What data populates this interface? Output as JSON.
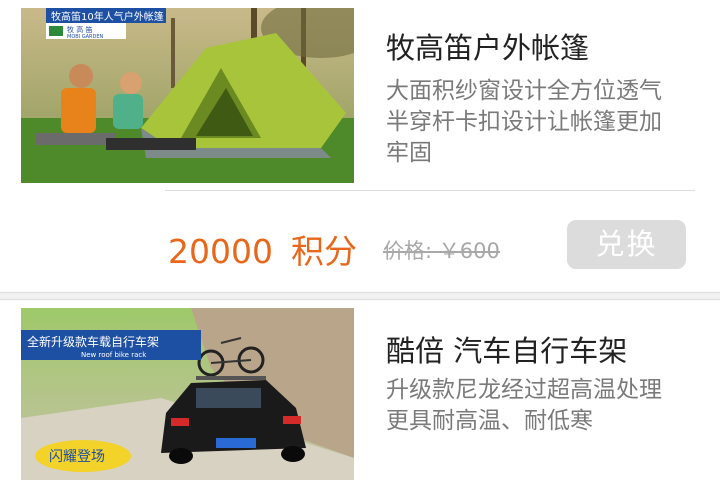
{
  "products": [
    {
      "title": "牧高笛户外帐篷",
      "description_lines": [
        "大面积纱窗设计全方位透气",
        "半穿杆卡扣设计让帐篷更加",
        "牢固"
      ],
      "points": "20000",
      "points_unit": "积分",
      "original_price": "价格: ￥600",
      "redeem_label": "兑换",
      "image": {
        "banner_text": "牧高笛10年人气户外帐篷",
        "logo_text": "牧 高 笛",
        "logo_subtext": "MOBI GARDEN",
        "tent_color": "#a8c43a"
      }
    },
    {
      "title": "酷倍 汽车自行车架",
      "description_lines": [
        "升级款尼龙经过超高温处理",
        "更具耐高温、耐低寒"
      ],
      "image": {
        "banner_text": "全新升级款车载自行车架",
        "banner_subtext": "New roof bike rack",
        "badge_text": "闪耀登场"
      }
    }
  ],
  "colors": {
    "accent": "#e8671b",
    "button_disabled": "#dcdcdc",
    "muted_text": "#7a7a7a"
  }
}
